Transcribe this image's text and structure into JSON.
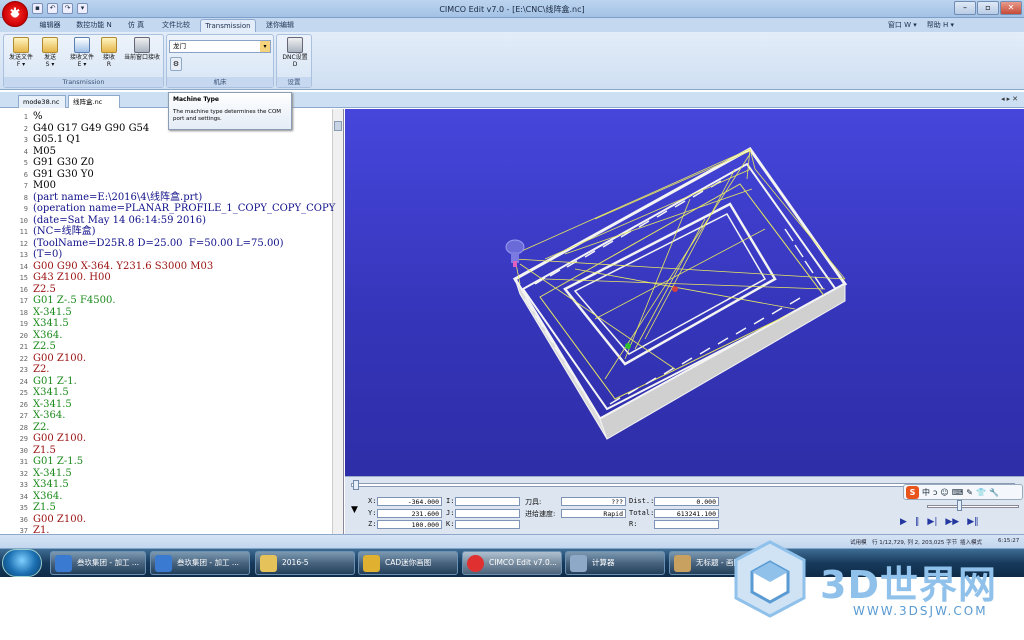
{
  "window": {
    "title": "CIMCO Edit v7.0 - [E:\\CNC\\线阵盒.nc]"
  },
  "ribbon_tabs": [
    "编辑器",
    "数控功能 N",
    "仿 真",
    "文件比较",
    "Transmission",
    "迷你编辑"
  ],
  "menu_right": [
    "窗口 W ▾",
    "帮助 H ▾"
  ],
  "ribbon": {
    "send_file": "发送文件\nF ▾",
    "send": "发送\nS ▾",
    "receive_file": "接收文件\nE ▾",
    "receive": "接收\nR",
    "current_window_receive": "当前窗口接收",
    "transmission_label": "Transmission",
    "machine_value": "龙门",
    "machine_label": "机床",
    "dnc_settings": "DNC设置\nD",
    "settings_label": "设置"
  },
  "tooltip": {
    "title": "Machine Type",
    "body": "The machine type determines the COM port and settings."
  },
  "doc_tabs": [
    "mode38.nc",
    "线阵盒.nc"
  ],
  "code_lines": [
    {
      "n": "1",
      "t": "%",
      "c": "#000"
    },
    {
      "n": "2",
      "t": "G40 G17 G49 G90 G54",
      "c": "#000"
    },
    {
      "n": "3",
      "t": "G05.1 Q1",
      "c": "#000"
    },
    {
      "n": "4",
      "t": "M05",
      "c": "#000"
    },
    {
      "n": "5",
      "t": "G91 G30 Z0",
      "c": "#000"
    },
    {
      "n": "6",
      "t": "G91 G30 Y0",
      "c": "#000"
    },
    {
      "n": "7",
      "t": "M00",
      "c": "#000"
    },
    {
      "n": "8",
      "t": "(part name=E:\\2016\\4\\线阵盒.prt)",
      "c": "#10108a"
    },
    {
      "n": "9",
      "t": "(operation name=PLANAR_PROFILE_1_COPY_COPY_COPY",
      "c": "#10108a"
    },
    {
      "n": "10",
      "t": "(date=Sat May 14 06:14:59 2016)",
      "c": "#10108a"
    },
    {
      "n": "11",
      "t": "(NC=线阵盒)",
      "c": "#10108a"
    },
    {
      "n": "12",
      "t": "(ToolName=D25R.8 D=25.00  F=50.00 L=75.00)",
      "c": "#10108a"
    },
    {
      "n": "13",
      "t": "(T=0)",
      "c": "#10108a"
    },
    {
      "n": "14",
      "t": "G00 G90 X-364. Y231.6 S3000 M03",
      "c": "#9a1010"
    },
    {
      "n": "15",
      "t": "G43 Z100. H00",
      "c": "#9a1010"
    },
    {
      "n": "16",
      "t": "Z2.5",
      "c": "#9a1010"
    },
    {
      "n": "17",
      "t": "G01 Z-.5 F4500.",
      "c": "#1b8a1b"
    },
    {
      "n": "18",
      "t": "X-341.5",
      "c": "#1b8a1b"
    },
    {
      "n": "19",
      "t": "X341.5",
      "c": "#1b8a1b"
    },
    {
      "n": "20",
      "t": "X364.",
      "c": "#1b8a1b"
    },
    {
      "n": "21",
      "t": "Z2.5",
      "c": "#1b8a1b"
    },
    {
      "n": "22",
      "t": "G00 Z100.",
      "c": "#9a1010"
    },
    {
      "n": "23",
      "t": "Z2.",
      "c": "#9a1010"
    },
    {
      "n": "24",
      "t": "G01 Z-1.",
      "c": "#1b8a1b"
    },
    {
      "n": "25",
      "t": "X341.5",
      "c": "#1b8a1b"
    },
    {
      "n": "26",
      "t": "X-341.5",
      "c": "#1b8a1b"
    },
    {
      "n": "27",
      "t": "X-364.",
      "c": "#1b8a1b"
    },
    {
      "n": "28",
      "t": "Z2.",
      "c": "#1b8a1b"
    },
    {
      "n": "29",
      "t": "G00 Z100.",
      "c": "#9a1010"
    },
    {
      "n": "30",
      "t": "Z1.5",
      "c": "#9a1010"
    },
    {
      "n": "31",
      "t": "G01 Z-1.5",
      "c": "#1b8a1b"
    },
    {
      "n": "32",
      "t": "X-341.5",
      "c": "#1b8a1b"
    },
    {
      "n": "33",
      "t": "X341.5",
      "c": "#1b8a1b"
    },
    {
      "n": "34",
      "t": "X364.",
      "c": "#1b8a1b"
    },
    {
      "n": "35",
      "t": "Z1.5",
      "c": "#1b8a1b"
    },
    {
      "n": "36",
      "t": "G00 Z100.",
      "c": "#9a1010"
    },
    {
      "n": "37",
      "t": "Z1.",
      "c": "#9a1010"
    }
  ],
  "sim": {
    "x_label": "X:",
    "x": "-364.000",
    "y_label": "Y:",
    "y": "231.600",
    "z_label": "Z:",
    "z": "100.000",
    "i_label": "I:",
    "j_label": "J:",
    "k_label": "K:",
    "tool_label": "刀具:",
    "tool": "???",
    "feed_label": "进给速度:",
    "feed": "Rapid",
    "dist_label": "Dist.:",
    "dist": "0.000",
    "total_label": "Total:",
    "total": "613241.100",
    "r_label": "R:"
  },
  "ime": {
    "s": "S",
    "items": [
      "中",
      "ↄ",
      "☺",
      "⌨",
      "✎",
      "👕",
      "🔧"
    ]
  },
  "status": {
    "mode": "试用模",
    "pos": "行 1/12,729, 列 2, 203,025 字节",
    "ins": "插入模式",
    "time": "6:15:27"
  },
  "taskbar": [
    "叁玖集团 - 加工 ...",
    "叁玖集团 - 加工 ...",
    "2016-5",
    "CAD迷你画图",
    "CIMCO Edit v7.0...",
    "计算器",
    "无标题 - 画图"
  ],
  "watermark": {
    "text": "3D世界网",
    "url": "WWW.3DSJW.COM"
  },
  "colors": {
    "viewport": "#3838c8",
    "toolpath": "#e8e860",
    "part": "#f4f4f4"
  }
}
